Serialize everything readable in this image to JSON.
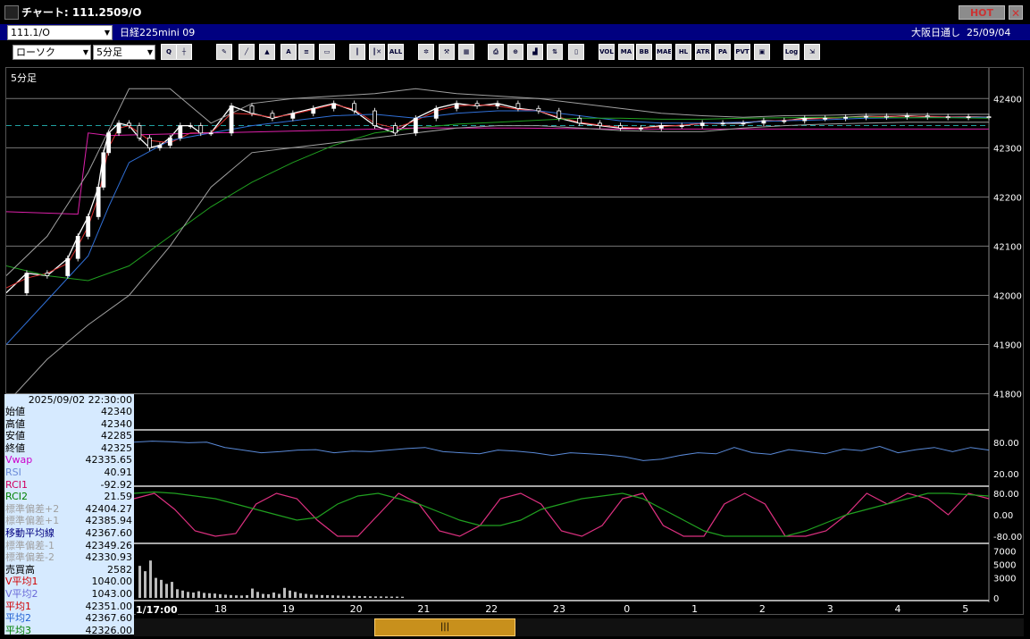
{
  "window": {
    "title": "チャート: 111.2509/O",
    "hot_label": "HOT",
    "close_label": "✕"
  },
  "info": {
    "symbol": "111.1/O",
    "contract": "日経225mini 09",
    "market": "大阪日通し",
    "date": "25/09/04"
  },
  "toolbar": {
    "chart_type": "ローソク",
    "interval": "5分足",
    "buttons": [
      {
        "name": "zoom-icon",
        "label": "Q"
      },
      {
        "name": "crosshair-icon",
        "label": "┼"
      },
      {
        "name": "pen-icon",
        "label": "✎"
      },
      {
        "name": "line-icon",
        "label": "╱"
      },
      {
        "name": "cursor-icon",
        "label": "▲"
      },
      {
        "name": "text-icon",
        "label": "A"
      },
      {
        "name": "document-icon",
        "label": "≡"
      },
      {
        "name": "trash-icon",
        "label": "▭"
      },
      {
        "name": "candle-icon",
        "label": "┃"
      },
      {
        "name": "candle-delete-icon",
        "label": "┃✕"
      },
      {
        "name": "all-button",
        "label": "ALL"
      },
      {
        "name": "gear-icon",
        "label": "✲"
      },
      {
        "name": "wrench-icon",
        "label": "⚒"
      },
      {
        "name": "palette-icon",
        "label": "▦"
      },
      {
        "name": "print-icon",
        "label": "⎙"
      },
      {
        "name": "magnify-icon",
        "label": "⊕"
      },
      {
        "name": "bar-chart-icon",
        "label": "▟"
      },
      {
        "name": "compare-icon",
        "label": "⇅"
      },
      {
        "name": "blank-icon",
        "label": "▯"
      },
      {
        "name": "vol-button",
        "label": "VOL"
      },
      {
        "name": "ma-button",
        "label": "MA"
      },
      {
        "name": "bb-button",
        "label": "BB"
      },
      {
        "name": "mae-button",
        "label": "MAE"
      },
      {
        "name": "hl-button",
        "label": "HL"
      },
      {
        "name": "atr-button",
        "label": "ATR"
      },
      {
        "name": "pa-button",
        "label": "PA"
      },
      {
        "name": "pvt-button",
        "label": "PVT"
      },
      {
        "name": "window-icon",
        "label": "▣"
      },
      {
        "name": "log-button",
        "label": "Log"
      },
      {
        "name": "export-icon",
        "label": "⇲"
      }
    ]
  },
  "data_panel": {
    "datetime": "2025/09/02 22:30:00",
    "rows": [
      {
        "label": "始値",
        "value": "42340",
        "color": "#000000"
      },
      {
        "label": "高値",
        "value": "42340",
        "color": "#000000"
      },
      {
        "label": "安値",
        "value": "42285",
        "color": "#000000"
      },
      {
        "label": "終値",
        "value": "42325",
        "color": "#000000"
      },
      {
        "label": "Vwap",
        "value": "42335.65",
        "color": "#cc00cc"
      },
      {
        "label": "RSI",
        "value": "40.91",
        "color": "#6a8ad8"
      },
      {
        "label": "RCI1",
        "value": "-92.92",
        "color": "#d00060"
      },
      {
        "label": "RCI2",
        "value": "21.59",
        "color": "#008000"
      },
      {
        "label": "標準偏差+2",
        "value": "42404.27",
        "color": "#a0a0a0"
      },
      {
        "label": "標準偏差+1",
        "value": "42385.94",
        "color": "#a0a0a0"
      },
      {
        "label": "移動平均線",
        "value": "42367.60",
        "color": "#000080"
      },
      {
        "label": "標準偏差-1",
        "value": "42349.26",
        "color": "#a0a0a0"
      },
      {
        "label": "標準偏差-2",
        "value": "42330.93",
        "color": "#a0a0a0"
      },
      {
        "label": "売買高",
        "value": "2582",
        "color": "#000000"
      },
      {
        "label": "V平均1",
        "value": "1040.00",
        "color": "#d00000"
      },
      {
        "label": "V平均2",
        "value": "1043.00",
        "color": "#6a6ad8"
      },
      {
        "label": "平均1",
        "value": "42351.00",
        "color": "#d00000"
      },
      {
        "label": "平均2",
        "value": "42367.60",
        "color": "#2060d0"
      },
      {
        "label": "平均3",
        "value": "42326.00",
        "color": "#008000"
      }
    ]
  },
  "chart_data": {
    "type": "line",
    "main_label": "5分足",
    "price_axis": {
      "ticks": [
        42400,
        42300,
        42200,
        42100,
        42000,
        41900,
        41800
      ],
      "ylim": [
        41772,
        42455
      ]
    },
    "time_axis": {
      "day_label": "1/17:00",
      "ticks": [
        "18",
        "19",
        "20",
        "21",
        "22",
        "23",
        "0",
        "1",
        "2",
        "3",
        "4",
        "5"
      ]
    },
    "series": [
      {
        "role": "close",
        "color": "#ffffff",
        "x": [
          0,
          4,
          8,
          12,
          14,
          16,
          18,
          19,
          20,
          22,
          24,
          26,
          28,
          30,
          32,
          34,
          36,
          38,
          40,
          44,
          48,
          52,
          56,
          60,
          64,
          68,
          72,
          76,
          80,
          84,
          88,
          92,
          96,
          100,
          104,
          108,
          112,
          116,
          120,
          124,
          128,
          132,
          136,
          140,
          144,
          148,
          152,
          156,
          160,
          164,
          168,
          172,
          176,
          180,
          184,
          188,
          192
        ],
        "y": [
          42005,
          42045,
          42040,
          42075,
          42120,
          42160,
          42220,
          42290,
          42330,
          42350,
          42345,
          42320,
          42300,
          42305,
          42320,
          42345,
          42345,
          42330,
          42330,
          42385,
          42370,
          42360,
          42370,
          42380,
          42390,
          42375,
          42345,
          42330,
          42360,
          42380,
          42390,
          42385,
          42390,
          42380,
          42375,
          42360,
          42350,
          42345,
          42340,
          42340,
          42345,
          42345,
          42350,
          42350,
          42350,
          42355,
          42355,
          42360,
          42360,
          42362,
          42364,
          42363,
          42365,
          42363,
          42362,
          42363,
          42362
        ]
      },
      {
        "role": "ma-short",
        "color": "#dd3030",
        "x": [
          0,
          4,
          8,
          12,
          14,
          16,
          18,
          20,
          22,
          24,
          28,
          32,
          36,
          40,
          44,
          48,
          52,
          56,
          60,
          64,
          68,
          72,
          76,
          80,
          84,
          88,
          92,
          96,
          100,
          104,
          108,
          112,
          116,
          120,
          124,
          128,
          132,
          136,
          140,
          144,
          148,
          152,
          156,
          160,
          164,
          168,
          172,
          176,
          180,
          184,
          188,
          192
        ],
        "y": [
          42015,
          42035,
          42045,
          42065,
          42100,
          42140,
          42200,
          42300,
          42340,
          42345,
          42315,
          42310,
          42330,
          42330,
          42370,
          42368,
          42362,
          42368,
          42378,
          42388,
          42378,
          42350,
          42340,
          42355,
          42375,
          42385,
          42387,
          42385,
          42378,
          42375,
          42362,
          42352,
          42346,
          42342,
          42340,
          42343,
          42346,
          42349,
          42351,
          42352,
          42354,
          42356,
          42358,
          42360,
          42362,
          42363,
          42364,
          42364,
          42364,
          42363,
          42363,
          42362
        ]
      },
      {
        "role": "ma-mid",
        "color": "#3070d8",
        "x": [
          0,
          8,
          16,
          20,
          24,
          32,
          40,
          48,
          56,
          64,
          72,
          80,
          88,
          96,
          104,
          112,
          120,
          128,
          136,
          144,
          152,
          160,
          168,
          176,
          184,
          192
        ],
        "y": [
          41900,
          41990,
          42080,
          42180,
          42270,
          42315,
          42330,
          42345,
          42355,
          42365,
          42368,
          42360,
          42370,
          42375,
          42375,
          42365,
          42355,
          42350,
          42350,
          42352,
          42355,
          42357,
          42360,
          42361,
          42362,
          42362
        ]
      },
      {
        "role": "ma-long",
        "color": "#20a020",
        "x": [
          0,
          8,
          16,
          24,
          32,
          40,
          48,
          56,
          64,
          72,
          80,
          88,
          96,
          104,
          112,
          120,
          128,
          136,
          144,
          152,
          160,
          168,
          176,
          184,
          192
        ],
        "y": [
          42060,
          42040,
          42030,
          42060,
          42120,
          42180,
          42230,
          42270,
          42305,
          42330,
          42340,
          42348,
          42352,
          42356,
          42360,
          42360,
          42358,
          42358,
          42360,
          42361,
          42362,
          42362,
          42361,
          42361,
          42360
        ]
      },
      {
        "role": "vwap",
        "color": "#dd20aa",
        "x": [
          0,
          14,
          16,
          20,
          40,
          60,
          80,
          100,
          120,
          140,
          160,
          192
        ],
        "y": [
          42170,
          42165,
          42330,
          42325,
          42330,
          42335,
          42340,
          42340,
          42338,
          42338,
          42338,
          42338
        ]
      },
      {
        "role": "bb-upper",
        "color": "#a0a0a0",
        "x": [
          0,
          8,
          16,
          24,
          32,
          40,
          48,
          56,
          64,
          72,
          80,
          88,
          96,
          104,
          112,
          120,
          128,
          136,
          144,
          152,
          160,
          168,
          176,
          184,
          192
        ],
        "y": [
          42040,
          42120,
          42250,
          42420,
          42420,
          42350,
          42390,
          42400,
          42405,
          42410,
          42420,
          42410,
          42405,
          42400,
          42390,
          42380,
          42370,
          42365,
          42362,
          42365,
          42366,
          42368,
          42368,
          42368,
          42368
        ]
      },
      {
        "role": "bb-lower",
        "color": "#a0a0a0",
        "x": [
          0,
          8,
          16,
          24,
          32,
          40,
          48,
          56,
          64,
          72,
          80,
          88,
          96,
          104,
          112,
          120,
          128,
          136,
          144,
          152,
          160,
          168,
          176,
          184,
          192
        ],
        "y": [
          41780,
          41870,
          41940,
          42000,
          42100,
          42220,
          42290,
          42300,
          42310,
          42320,
          42330,
          42340,
          42345,
          42345,
          42340,
          42335,
          42333,
          42333,
          42340,
          42345,
          42348,
          42350,
          42352,
          42352,
          42352
        ]
      }
    ],
    "dashed_level": 42345,
    "rsi": {
      "ticks": [
        80,
        20
      ],
      "values": [
        80,
        82,
        81,
        79,
        80,
        70,
        65,
        60,
        62,
        65,
        66,
        60,
        63,
        62,
        65,
        68,
        70,
        62,
        60,
        58,
        65,
        63,
        60,
        55,
        60,
        58,
        56,
        52,
        45,
        48,
        55,
        60,
        58,
        70,
        60,
        57,
        66,
        62,
        58,
        67,
        64,
        72,
        60,
        66,
        70,
        62,
        70,
        65
      ]
    },
    "rci": {
      "ticks": [
        80,
        0,
        -80
      ],
      "rci1": [
        60,
        80,
        20,
        -60,
        -80,
        -70,
        40,
        80,
        60,
        -20,
        -80,
        -80,
        0,
        80,
        40,
        -60,
        -80,
        -40,
        60,
        80,
        40,
        -60,
        -80,
        -40,
        60,
        80,
        -40,
        -80,
        -80,
        40,
        80,
        40,
        -80,
        -80,
        -60,
        0,
        80,
        40,
        80,
        60,
        0,
        80,
        60
      ],
      "rci2": [
        80,
        85,
        80,
        70,
        60,
        40,
        20,
        0,
        -20,
        -10,
        40,
        70,
        80,
        60,
        40,
        10,
        -20,
        -40,
        -40,
        -20,
        20,
        40,
        60,
        70,
        80,
        60,
        20,
        -20,
        -60,
        -80,
        -80,
        -80,
        -80,
        -60,
        -30,
        0,
        20,
        40,
        60,
        80,
        80,
        75,
        70
      ]
    },
    "volume": {
      "ticks": [
        7000,
        5000,
        3000,
        0
      ],
      "values": [
        4800,
        4000,
        5600,
        3000,
        2700,
        2100,
        2400,
        1300,
        1100,
        900,
        800,
        1000,
        750,
        700,
        650,
        550,
        480,
        420,
        380,
        360,
        400,
        1400,
        900,
        600,
        550,
        800,
        600,
        1500,
        1100,
        900,
        700,
        600,
        500,
        450,
        420,
        400,
        380,
        350,
        320,
        300,
        300,
        280,
        260,
        240,
        230,
        220,
        210,
        200,
        190,
        180
      ]
    }
  }
}
